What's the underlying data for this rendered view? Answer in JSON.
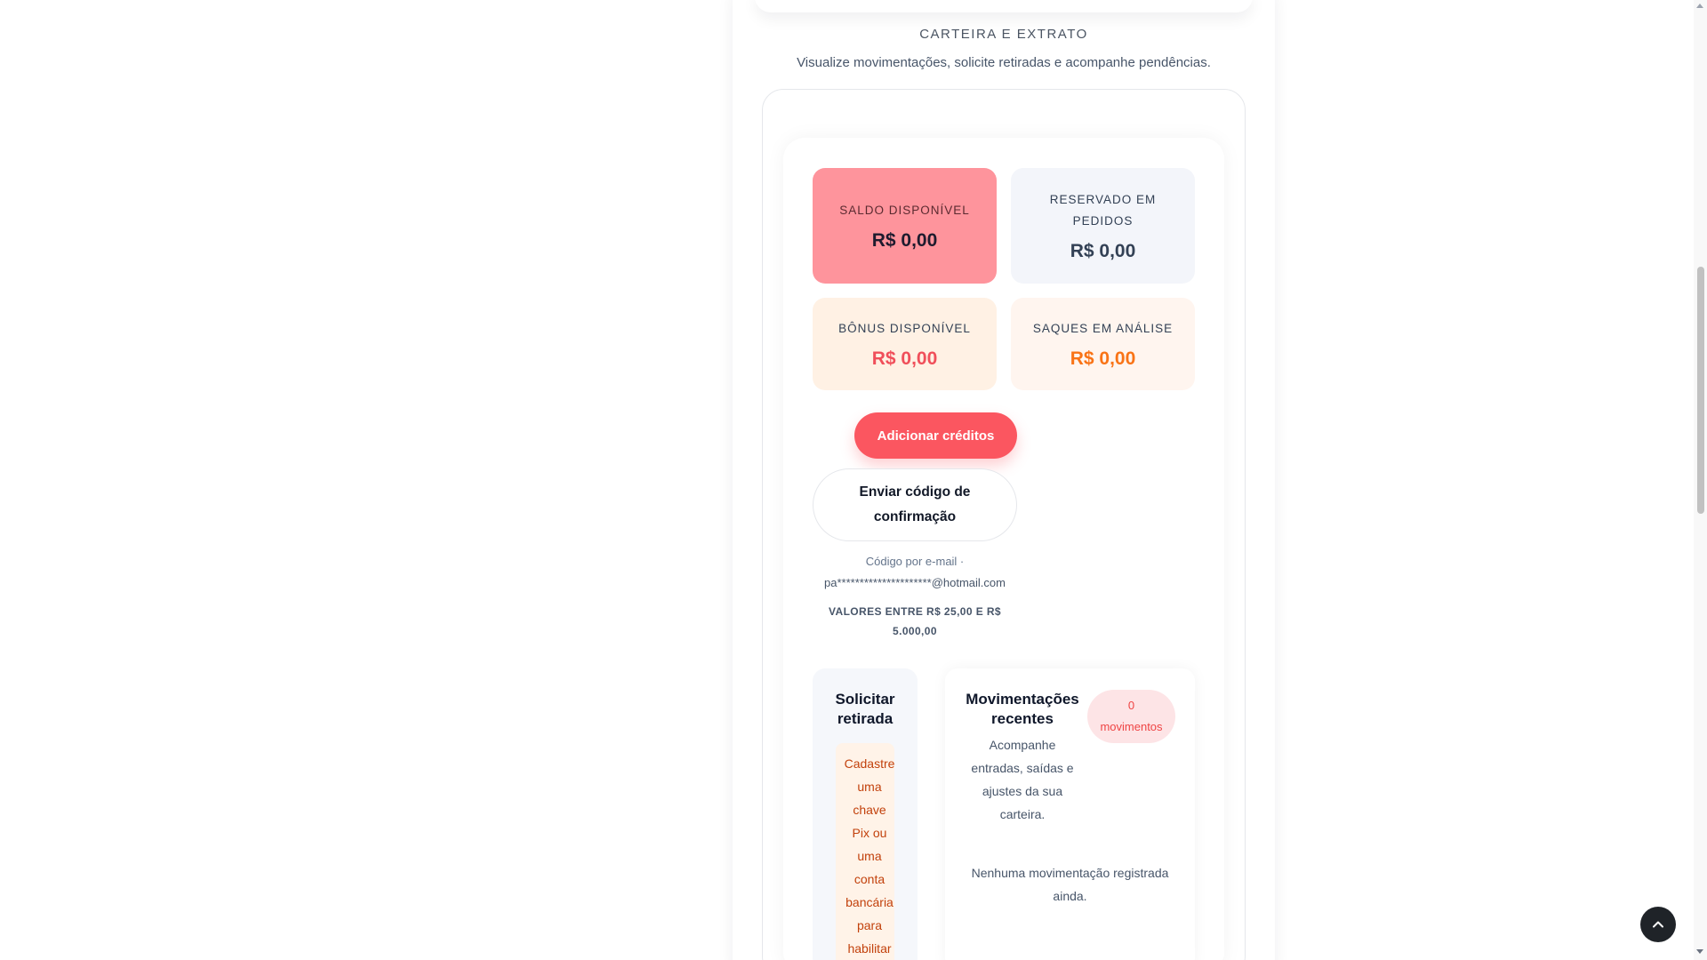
{
  "section": {
    "title": "CARTEIRA E EXTRATO",
    "subtitle": "Visualize movimentações, solicite retiradas e acompanhe pendências."
  },
  "stats": {
    "saldo": {
      "label": "SALDO DISPONÍVEL",
      "value": "R$ 0,00",
      "color": "#fe949c"
    },
    "reservado": {
      "label": "RESERVADO EM PEDIDOS",
      "value": "R$ 0,00",
      "color": "#f3f5fa"
    },
    "bonus": {
      "label": "BÔNUS DISPONÍVEL",
      "value": "R$ 0,00",
      "color": "#fff1e4"
    },
    "saques": {
      "label": "SAQUES EM ANÁLISE",
      "value": "R$ 0,00",
      "color": "#fff5ef"
    }
  },
  "actions": {
    "add_credits_label": "Adicionar créditos",
    "send_code_label": "Enviar código de confirmação",
    "code_info_prefix": "Código por e-mail ·",
    "code_email": "pa*********************@hotmail.com",
    "limits": "VALORES ENTRE R$ 25,00 E R$ 5.000,00"
  },
  "withdraw": {
    "title": "Solicitar retirada",
    "alert": "Cadastre uma chave Pix ou uma conta bancária para habilitar"
  },
  "movements": {
    "title": "Movimentações recentes",
    "description": "Acompanhe entradas, saídas e ajustes da sua carteira.",
    "badge_count": "0",
    "badge_unit": "movimentos",
    "empty": "Nenhuma movimentação registrada ainda."
  },
  "colors": {
    "accent": "#fb5660",
    "warning_text": "#c2410c",
    "pending_orange": "#f97316"
  },
  "icons": {
    "back_to_top": "chevron-up-icon"
  }
}
